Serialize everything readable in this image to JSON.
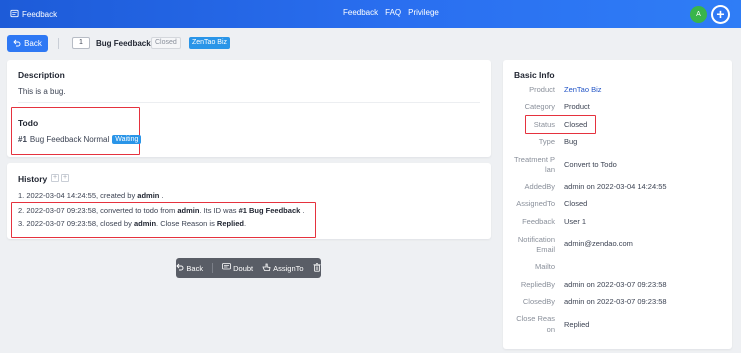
{
  "topbar": {
    "brand": "Feedback",
    "nav": [
      "Feedback",
      "FAQ",
      "Privilege"
    ],
    "avatar_initial": "A",
    "accent_color": "#2e78f4"
  },
  "header": {
    "back_label": "Back",
    "id": "1",
    "title": "Bug Feedback",
    "status_tag": "Closed",
    "product_tag": "ZenTao Biz"
  },
  "description": {
    "title": "Description",
    "text": "This is a bug."
  },
  "todo": {
    "title": "Todo",
    "id": "#1",
    "name": "Bug Feedback",
    "priority": "Normal",
    "status": "Waiting"
  },
  "history": {
    "title": "History",
    "items": [
      {
        "num": "1.",
        "pre": "2022-03-04 14:24:55, created by",
        "actor": "admin",
        "post": "."
      },
      {
        "num": "2.",
        "pre": "2022-03-07 09:23:58, converted to todo from",
        "actor": "admin",
        "mid": ". Its ID was",
        "extra": "#1 Bug Feedback",
        "post": "."
      },
      {
        "num": "3.",
        "pre": "2022-03-07 09:23:58, closed by",
        "actor": "admin",
        "mid": ". Close Reason is",
        "extra": "Replied",
        "post": "."
      }
    ]
  },
  "actions": {
    "back": "Back",
    "doubt": "Doubt",
    "assign_to": "AssignTo"
  },
  "basic_info": {
    "title": "Basic Info",
    "rows": [
      {
        "label": "Product",
        "value": "ZenTao Biz"
      },
      {
        "label": "Category",
        "value": "Product"
      },
      {
        "label": "Status",
        "value": "Closed"
      },
      {
        "label": "Type",
        "value": "Bug"
      },
      {
        "label_l1": "Treatment P",
        "label_l2": "lan",
        "value": "Convert to Todo"
      },
      {
        "label": "AddedBy",
        "value": "admin on 2022-03-04 14:24:55"
      },
      {
        "label": "AssignedTo",
        "value": "Closed"
      },
      {
        "label": "Feedback",
        "value": "User 1"
      },
      {
        "label_l1": "Notification",
        "label_l2": "Email",
        "value": "admin@zendao.com"
      },
      {
        "label": "Mailto",
        "value": ""
      },
      {
        "label": "RepliedBy",
        "value": "admin on 2022-03-07 09:23:58"
      },
      {
        "label": "ClosedBy",
        "value": "admin on 2022-03-07 09:23:58"
      },
      {
        "label_l1": "Close Reas",
        "label_l2": "on",
        "value": "Replied"
      }
    ]
  }
}
